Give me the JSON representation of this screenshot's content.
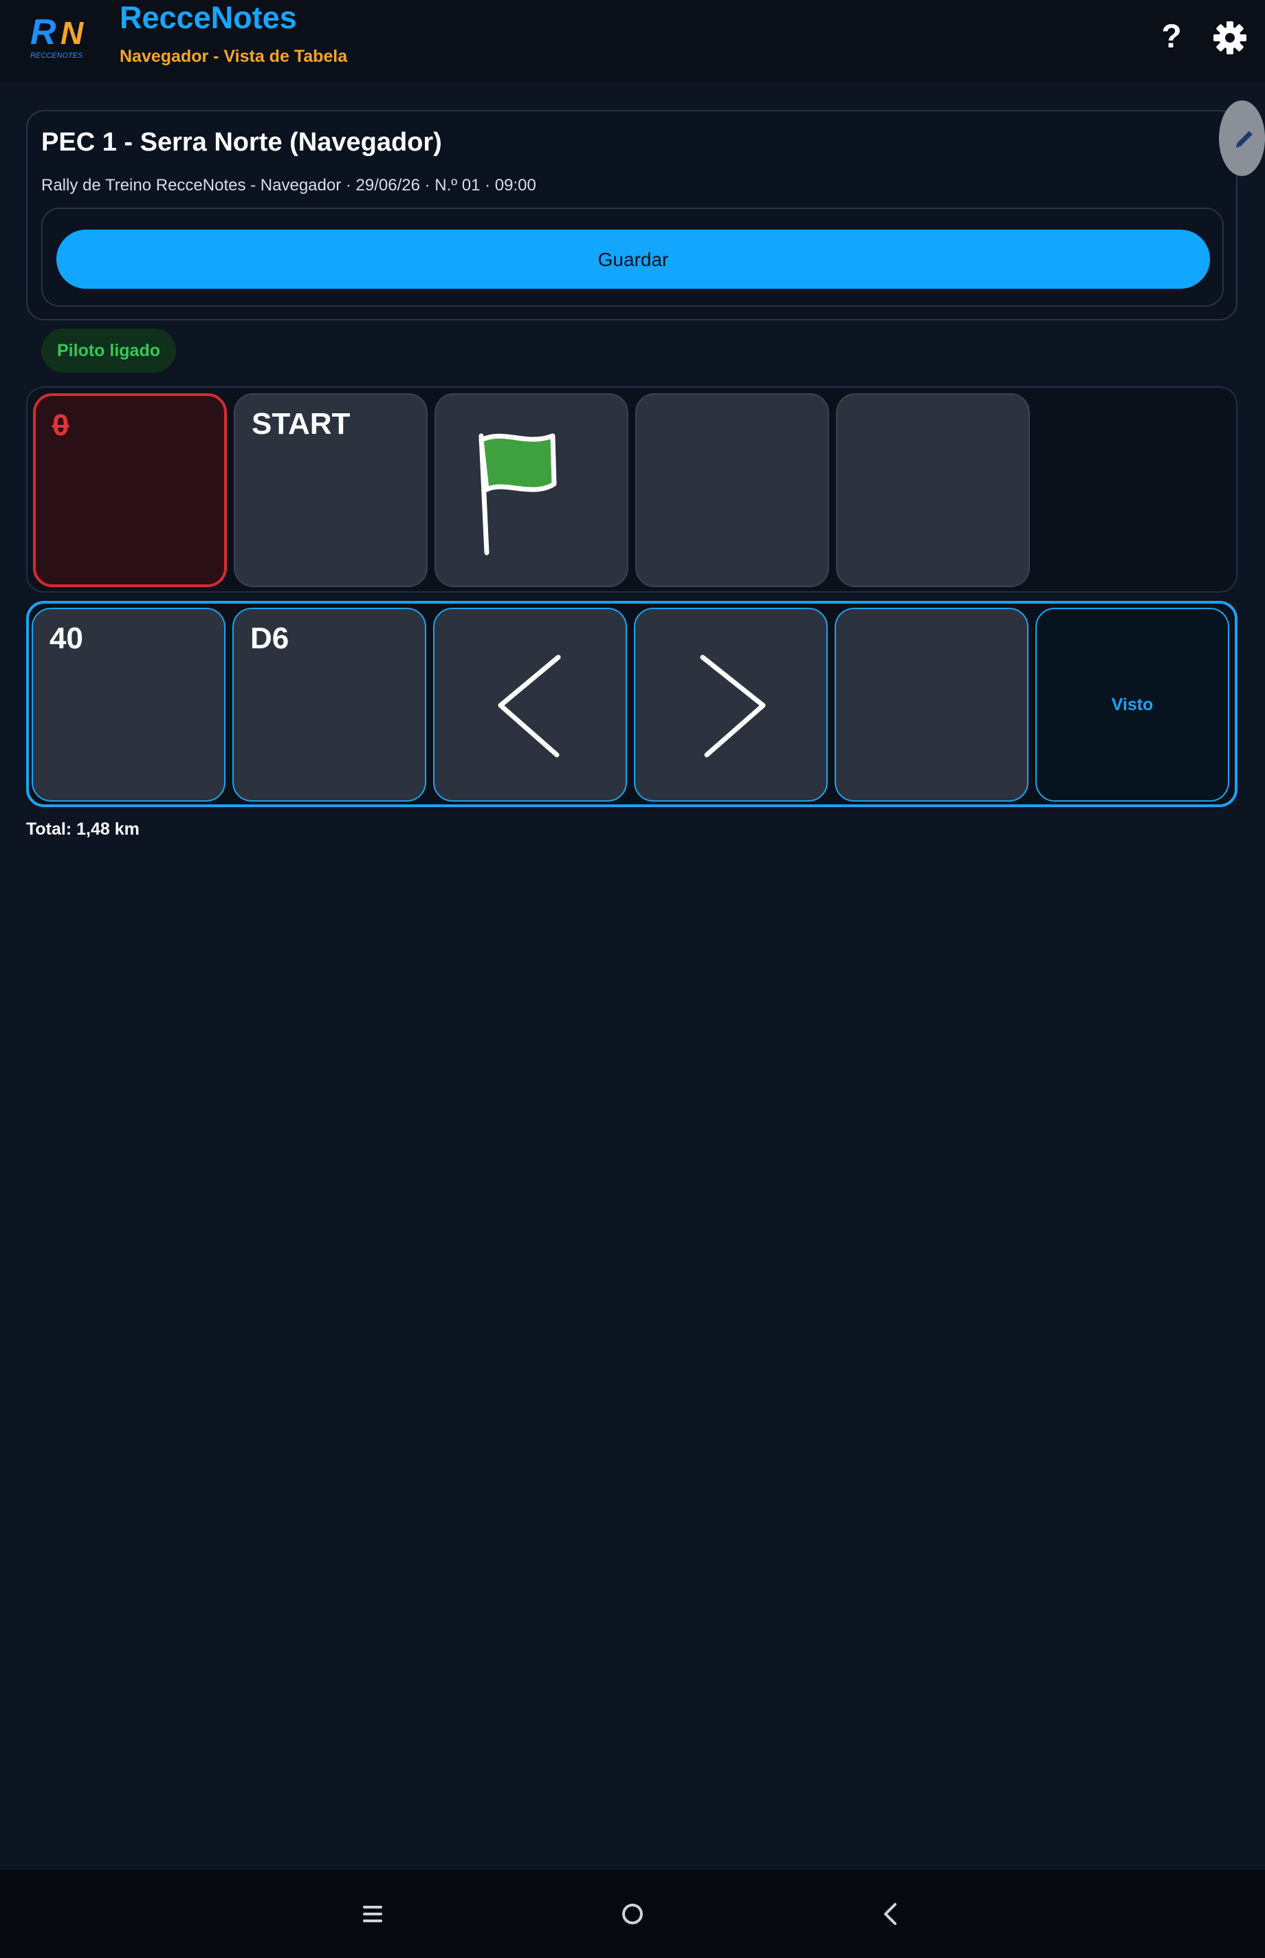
{
  "app": {
    "title": "RecceNotes",
    "subtitle": "Navegador - Vista de Tabela",
    "logo_text": "RN",
    "logo_caption": "RECCENOTES",
    "help_label": "?"
  },
  "stage": {
    "title": "PEC 1 - Serra Norte (Navegador)",
    "meta": "Rally de Treino RecceNotes - Navegador · 29/06/26 · N.º 01 · 09:00",
    "save_label": "Guardar"
  },
  "status_chip": "Piloto ligado",
  "rows": [
    {
      "cells": [
        {
          "text": "0",
          "style": "deleted"
        },
        {
          "text": "START"
        },
        {
          "icon": "green-flag-icon"
        },
        {
          "text": ""
        },
        {
          "text": ""
        }
      ]
    },
    {
      "selected": true,
      "cells": [
        {
          "text": "40"
        },
        {
          "text": "D6"
        },
        {
          "icon": "left-arrow-icon"
        },
        {
          "icon": "right-arrow-icon"
        },
        {
          "text": ""
        },
        {
          "label": "Visto"
        }
      ]
    }
  ],
  "total": "Total: 1,48 km",
  "colors": {
    "accent": "#13a6ff",
    "subtitle": "#f5a623",
    "chip_text": "#34c759",
    "deleted": "#d72a33",
    "flag": "#3fa03f"
  },
  "icons": [
    "help-icon",
    "gear-icon",
    "edit-icon",
    "menu-icon",
    "home-icon",
    "back-icon"
  ]
}
